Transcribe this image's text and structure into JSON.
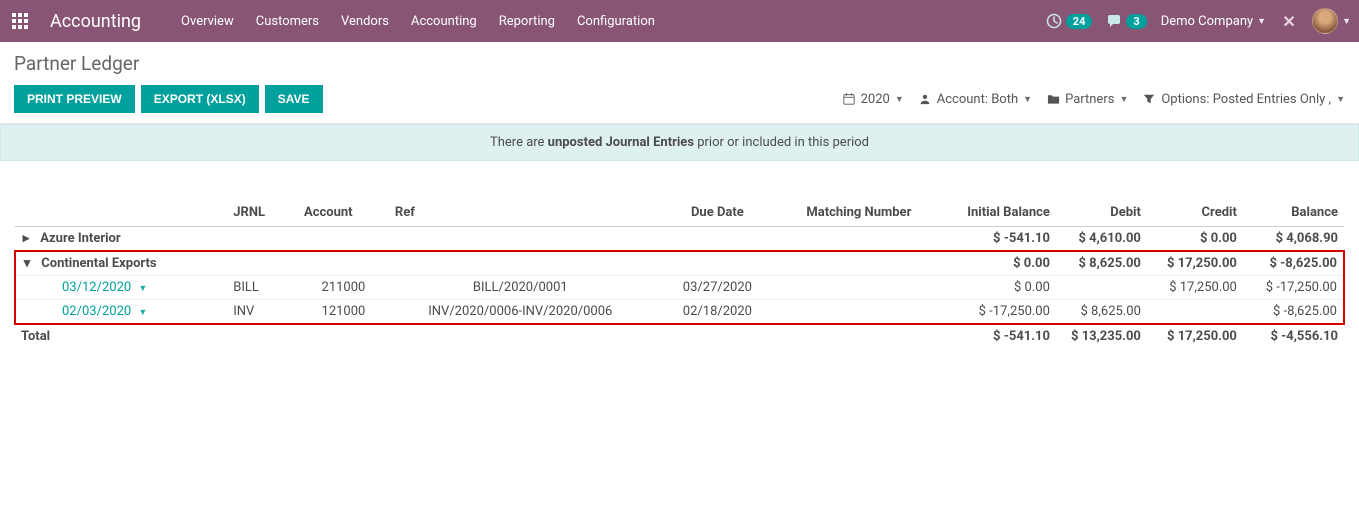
{
  "navbar": {
    "brand": "Accounting",
    "menu": [
      "Overview",
      "Customers",
      "Vendors",
      "Accounting",
      "Reporting",
      "Configuration"
    ],
    "activity_count": "24",
    "chat_count": "3",
    "company": "Demo Company"
  },
  "page": {
    "title": "Partner Ledger",
    "btn_print": "PRINT PREVIEW",
    "btn_export": "EXPORT (XLSX)",
    "btn_save": "SAVE"
  },
  "filters": {
    "year": "2020",
    "account_label": "Account: Both",
    "partners_label": "Partners",
    "options_label": "Options: Posted Entries Only ,"
  },
  "alert": {
    "prefix": "There are ",
    "bold": "unposted Journal Entries",
    "suffix": " prior or included in this period"
  },
  "table": {
    "headers": {
      "jrnl": "JRNL",
      "account": "Account",
      "ref": "Ref",
      "due": "Due Date",
      "match": "Matching Number",
      "initbal": "Initial Balance",
      "debit": "Debit",
      "credit": "Credit",
      "balance": "Balance"
    },
    "partner1": {
      "name": "Azure Interior",
      "initbal": "$ -541.10",
      "debit": "$ 4,610.00",
      "credit": "$ 0.00",
      "balance": "$ 4,068.90"
    },
    "partner2": {
      "name": "Continental Exports",
      "initbal": "$ 0.00",
      "debit": "$ 8,625.00",
      "credit": "$ 17,250.00",
      "balance": "$ -8,625.00"
    },
    "line1": {
      "date": "03/12/2020",
      "jrnl": "BILL",
      "account": "211000",
      "ref": "BILL/2020/0001",
      "due": "03/27/2020",
      "initbal": "$ 0.00",
      "debit": "",
      "credit": "$ 17,250.00",
      "balance": "$ -17,250.00"
    },
    "line2": {
      "date": "02/03/2020",
      "jrnl": "INV",
      "account": "121000",
      "ref": "INV/2020/0006-INV/2020/0006",
      "due": "02/18/2020",
      "initbal": "$ -17,250.00",
      "debit": "$ 8,625.00",
      "credit": "",
      "balance": "$ -8,625.00"
    },
    "total": {
      "label": "Total",
      "initbal": "$ -541.10",
      "debit": "$ 13,235.00",
      "credit": "$ 17,250.00",
      "balance": "$ -4,556.10"
    }
  }
}
